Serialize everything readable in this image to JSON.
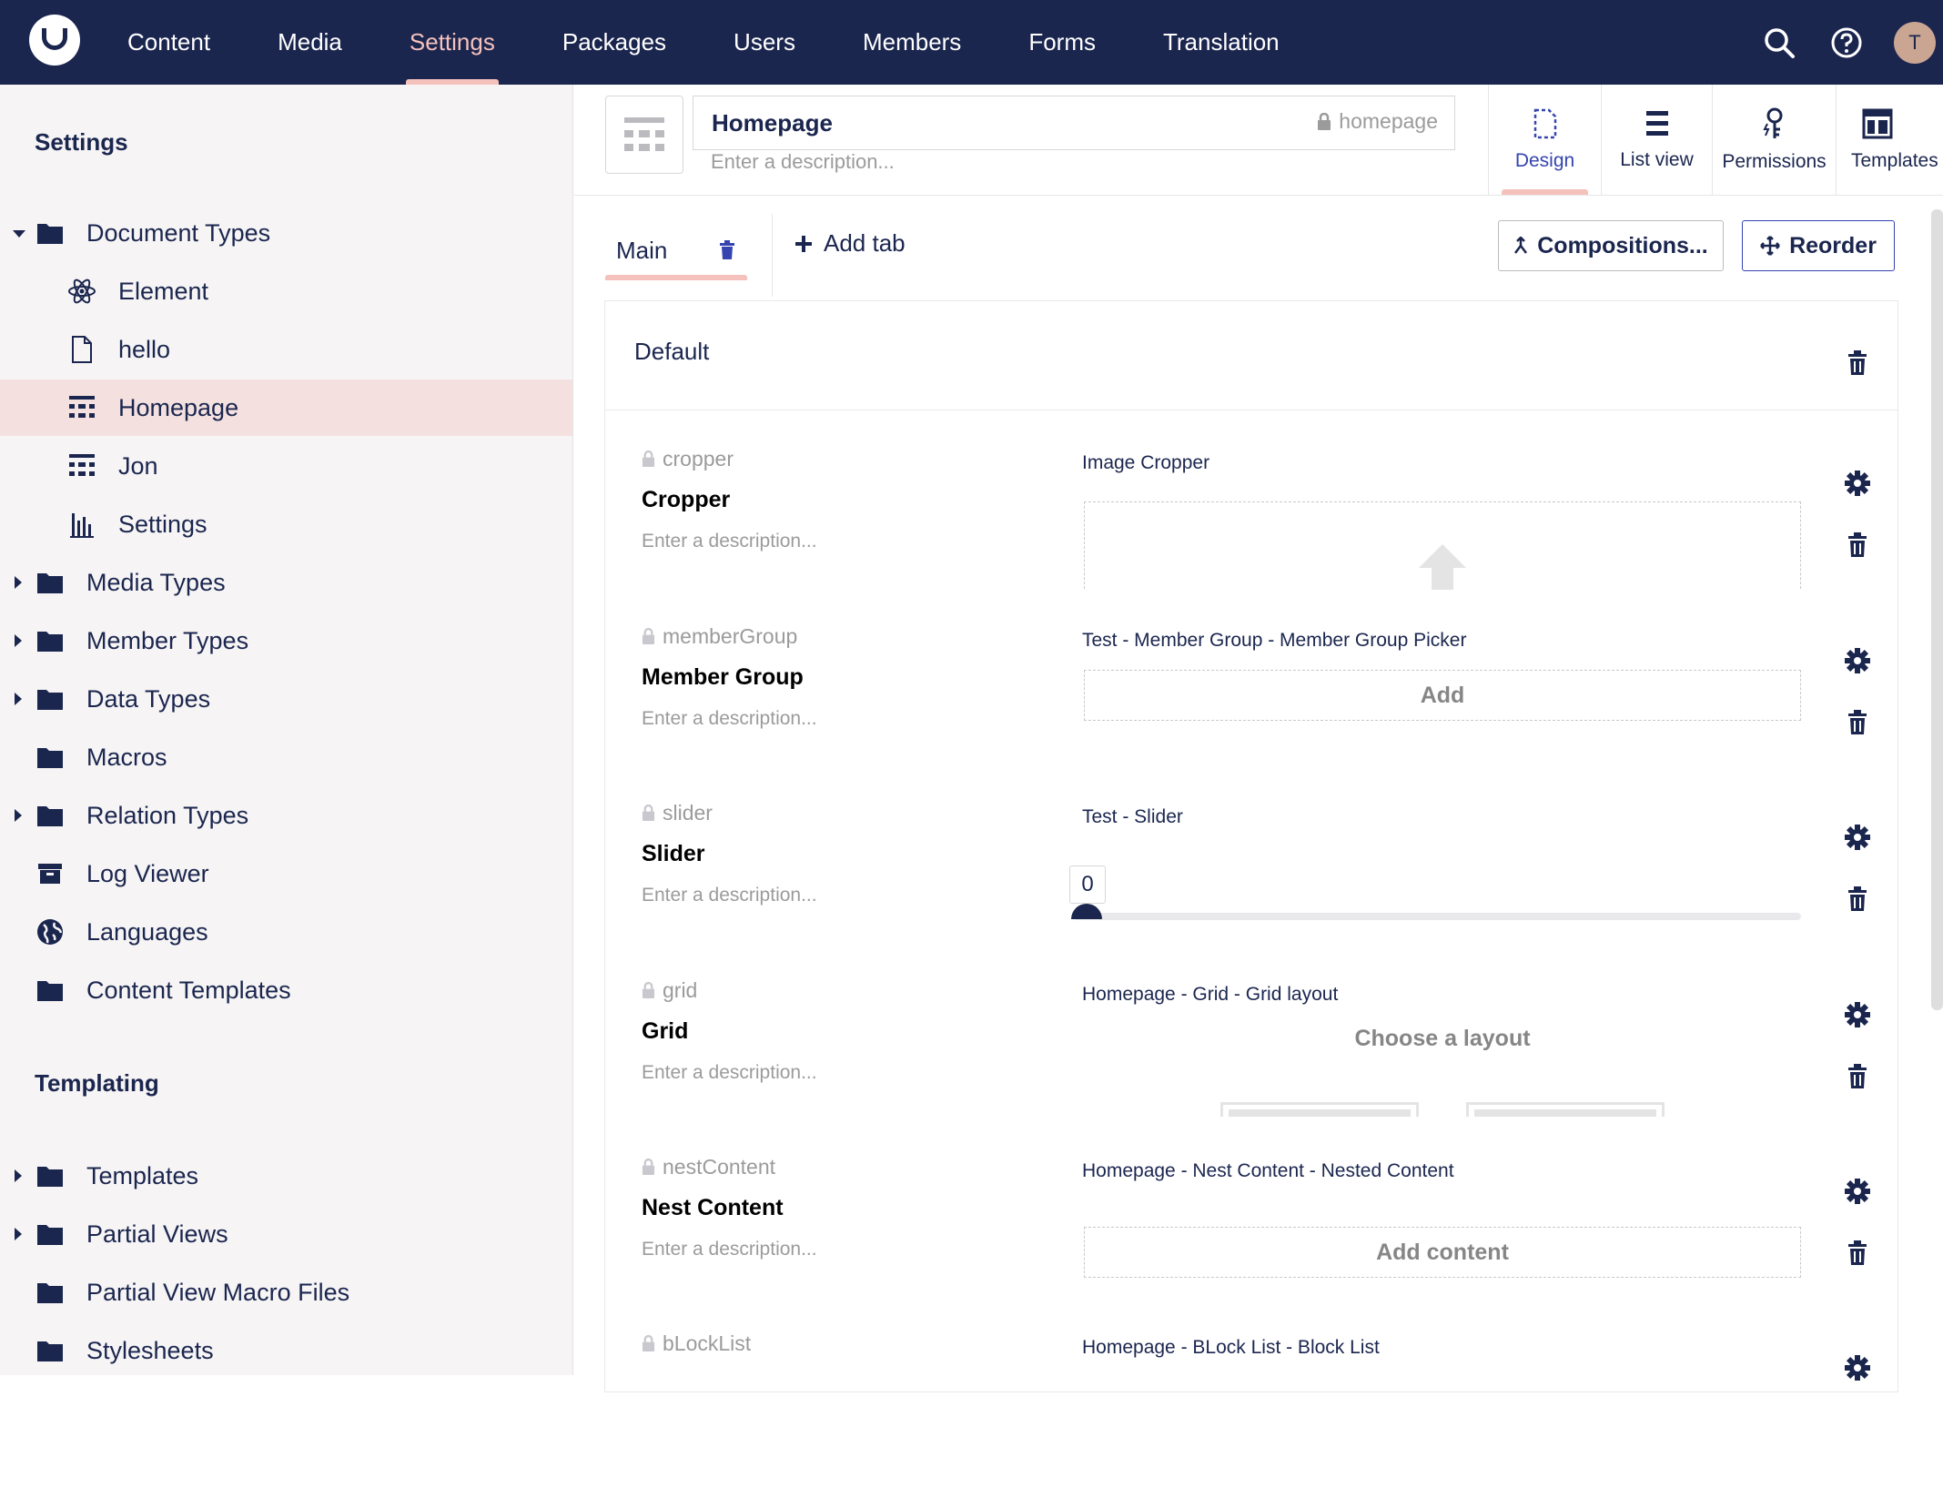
{
  "nav": {
    "items": [
      "Content",
      "Media",
      "Settings",
      "Packages",
      "Users",
      "Members",
      "Forms",
      "Translation"
    ],
    "active": "Settings",
    "avatar_initial": "T"
  },
  "sidebar": {
    "settings_heading": "Settings",
    "settings_items": [
      {
        "label": "Document Types",
        "icon": "folder-icon"
      },
      {
        "label": "Element",
        "icon": "atom-icon"
      },
      {
        "label": "hello",
        "icon": "document-icon"
      },
      {
        "label": "Homepage",
        "icon": "grid-icon"
      },
      {
        "label": "Jon",
        "icon": "grid-icon"
      },
      {
        "label": "Settings",
        "icon": "settings-chart-icon"
      },
      {
        "label": "Media Types",
        "icon": "folder-icon"
      },
      {
        "label": "Member Types",
        "icon": "folder-icon"
      },
      {
        "label": "Data Types",
        "icon": "folder-icon"
      },
      {
        "label": "Macros",
        "icon": "folder-icon"
      },
      {
        "label": "Relation Types",
        "icon": "folder-icon"
      },
      {
        "label": "Log Viewer",
        "icon": "box-icon"
      },
      {
        "label": "Languages",
        "icon": "globe-icon"
      },
      {
        "label": "Content Templates",
        "icon": "folder-icon"
      }
    ],
    "templating_heading": "Templating",
    "templating_items": [
      {
        "label": "Templates",
        "icon": "folder-icon"
      },
      {
        "label": "Partial Views",
        "icon": "folder-icon"
      },
      {
        "label": "Partial View Macro Files",
        "icon": "folder-icon"
      },
      {
        "label": "Stylesheets",
        "icon": "folder-icon"
      }
    ]
  },
  "header": {
    "name": "Homepage",
    "alias": "homepage",
    "description_placeholder": "Enter a description...",
    "app_tabs": [
      "Design",
      "List view",
      "Permissions",
      "Templates"
    ]
  },
  "toolbar": {
    "tab_name": "Main",
    "add_tab": "Add tab",
    "compositions": "Compositions...",
    "reorder": "Reorder"
  },
  "group": {
    "title": "Default",
    "properties": [
      {
        "alias": "cropper",
        "name": "Cropper",
        "desc": "Enter a description...",
        "editor": "Image Cropper"
      },
      {
        "alias": "memberGroup",
        "name": "Member Group",
        "desc": "Enter a description...",
        "editor": "Test - Member Group - Member Group Picker",
        "action": "Add"
      },
      {
        "alias": "slider",
        "name": "Slider",
        "desc": "Enter a description...",
        "editor": "Test - Slider",
        "value": "0"
      },
      {
        "alias": "grid",
        "name": "Grid",
        "desc": "Enter a description...",
        "editor": "Homepage - Grid - Grid layout",
        "action": "Choose a layout"
      },
      {
        "alias": "nestContent",
        "name": "Nest Content",
        "desc": "Enter a description...",
        "editor": "Homepage - Nest Content - Nested Content",
        "action": "Add content"
      },
      {
        "alias": "bLockList",
        "name": "",
        "desc": "",
        "editor": "Homepage - BLock List - Block List"
      }
    ]
  },
  "colors": {
    "topbar": "#1b264f",
    "accent": "#f5c1bc",
    "selected_row": "#f4e1df",
    "link": "#3544b1"
  }
}
